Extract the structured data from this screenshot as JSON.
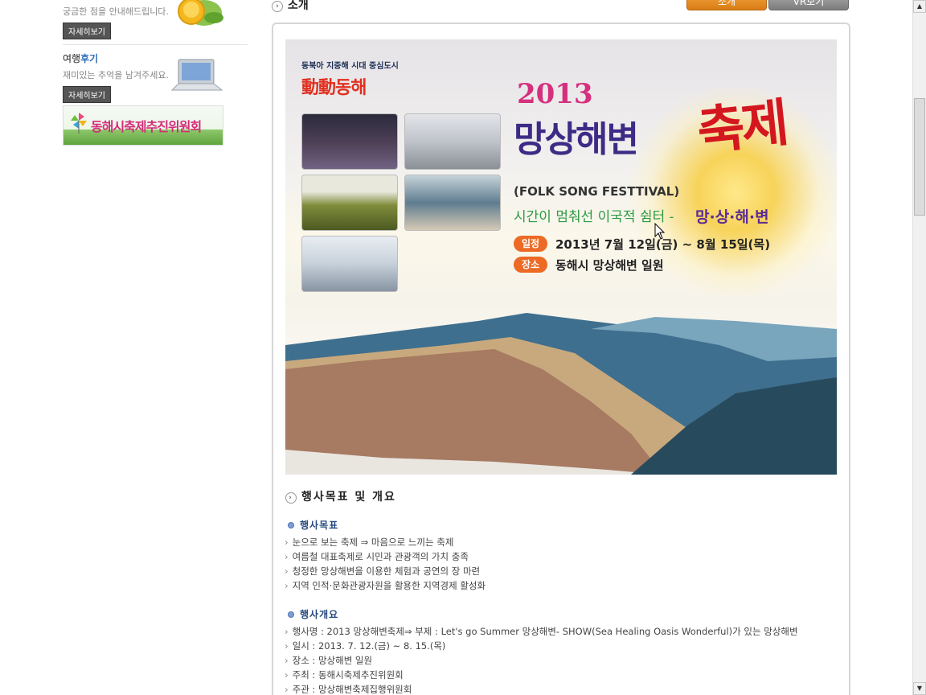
{
  "sidebar": {
    "guide": {
      "desc": "궁금한 점을 안내해드립니다.",
      "button": "자세히보기"
    },
    "review": {
      "title_prefix": "여행",
      "title_highlight": "후기",
      "desc": "재미있는 추억을 남겨주세요.",
      "button": "자세히보기"
    },
    "banner": "동해시축제추진위원회"
  },
  "main": {
    "section_title": "소개",
    "tabs": [
      "소개",
      "VR보기"
    ],
    "poster": {
      "slogan": "동북아 지중해 시대 중심도시",
      "logo": "動動동해",
      "year": "2013",
      "title": "망상해변",
      "title_red": "축제",
      "english": "(FOLK SONG FESTTIVAL)",
      "tagline": "시간이 멈춰선 이국적 쉼터 -",
      "place_name": "망·상·해·변",
      "schedule_tag": "일정",
      "schedule": "2013년 7월 12일(금) ~ 8월 15일(목)",
      "place_tag": "장소",
      "place": "동해시 망상해변 일원"
    },
    "overview_title": "행사목표 및 개요",
    "goals_title": "행사목표",
    "goals": [
      "눈으로 보는 축제 ⇒ 마음으로 느끼는 축제",
      "여름철 대표축제로 시민과 관광객의 가치 충족",
      "청정한 망상해변을 이용한 체험과 공연의 장 마련",
      "지역 인적·문화관광자원을 활용한 지역경제 활성화"
    ],
    "summary_title": "행사개요",
    "summary": [
      "행사명 : 2013 망상해변축제⇒ 부제 : Let's go Summer 망상해변- SHOW(Sea Healing Oasis Wonderful)가 있는 망상해변",
      "일시 : 2013. 7. 12.(금) ~ 8. 15.(목)",
      "장소 : 망상해변 일원",
      "주최 : 동해시축제추진위원회",
      "주관 : 망상해변축제집행위원회"
    ]
  },
  "colors": {
    "accent_orange": "#e8902a",
    "heading_blue": "#26497e",
    "poster_purple": "#3d2b86",
    "poster_red": "#d4171f"
  }
}
